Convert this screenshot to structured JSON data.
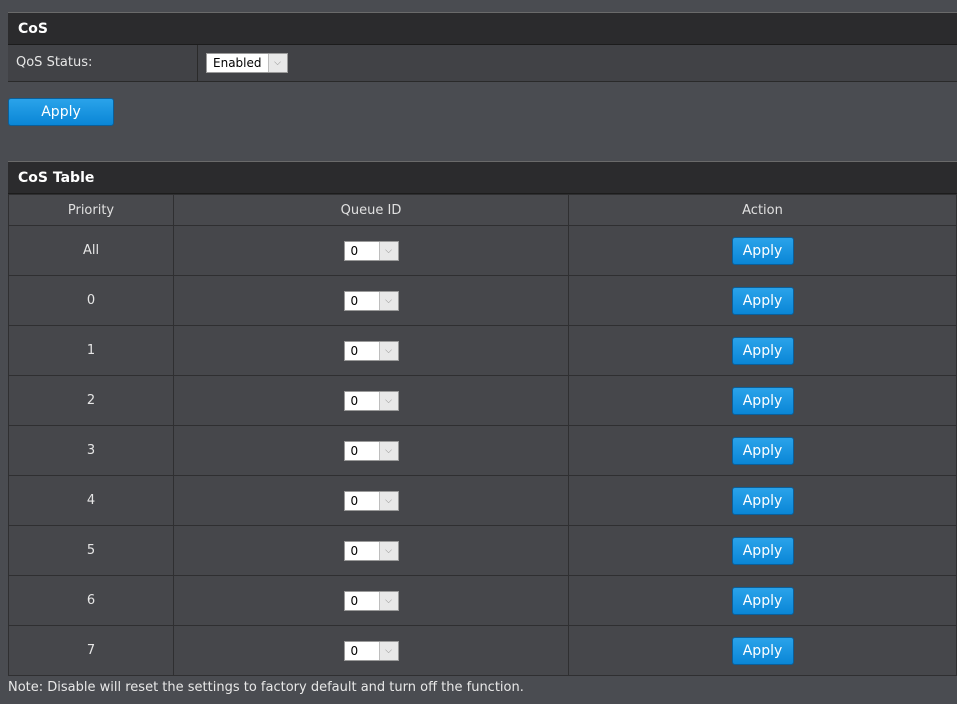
{
  "cos_section": {
    "title": "CoS",
    "qos_status_label": "QoS Status:",
    "qos_status_value": "Enabled",
    "apply_label": "Apply"
  },
  "cos_table": {
    "title": "CoS Table",
    "columns": [
      "Priority",
      "Queue ID",
      "Action"
    ],
    "rows": [
      {
        "priority": "All",
        "queue_id": "0",
        "action": "Apply"
      },
      {
        "priority": "0",
        "queue_id": "0",
        "action": "Apply"
      },
      {
        "priority": "1",
        "queue_id": "0",
        "action": "Apply"
      },
      {
        "priority": "2",
        "queue_id": "0",
        "action": "Apply"
      },
      {
        "priority": "3",
        "queue_id": "0",
        "action": "Apply"
      },
      {
        "priority": "4",
        "queue_id": "0",
        "action": "Apply"
      },
      {
        "priority": "5",
        "queue_id": "0",
        "action": "Apply"
      },
      {
        "priority": "6",
        "queue_id": "0",
        "action": "Apply"
      },
      {
        "priority": "7",
        "queue_id": "0",
        "action": "Apply"
      }
    ]
  },
  "note": "Note: Disable will reset the settings to factory default and turn off the function."
}
